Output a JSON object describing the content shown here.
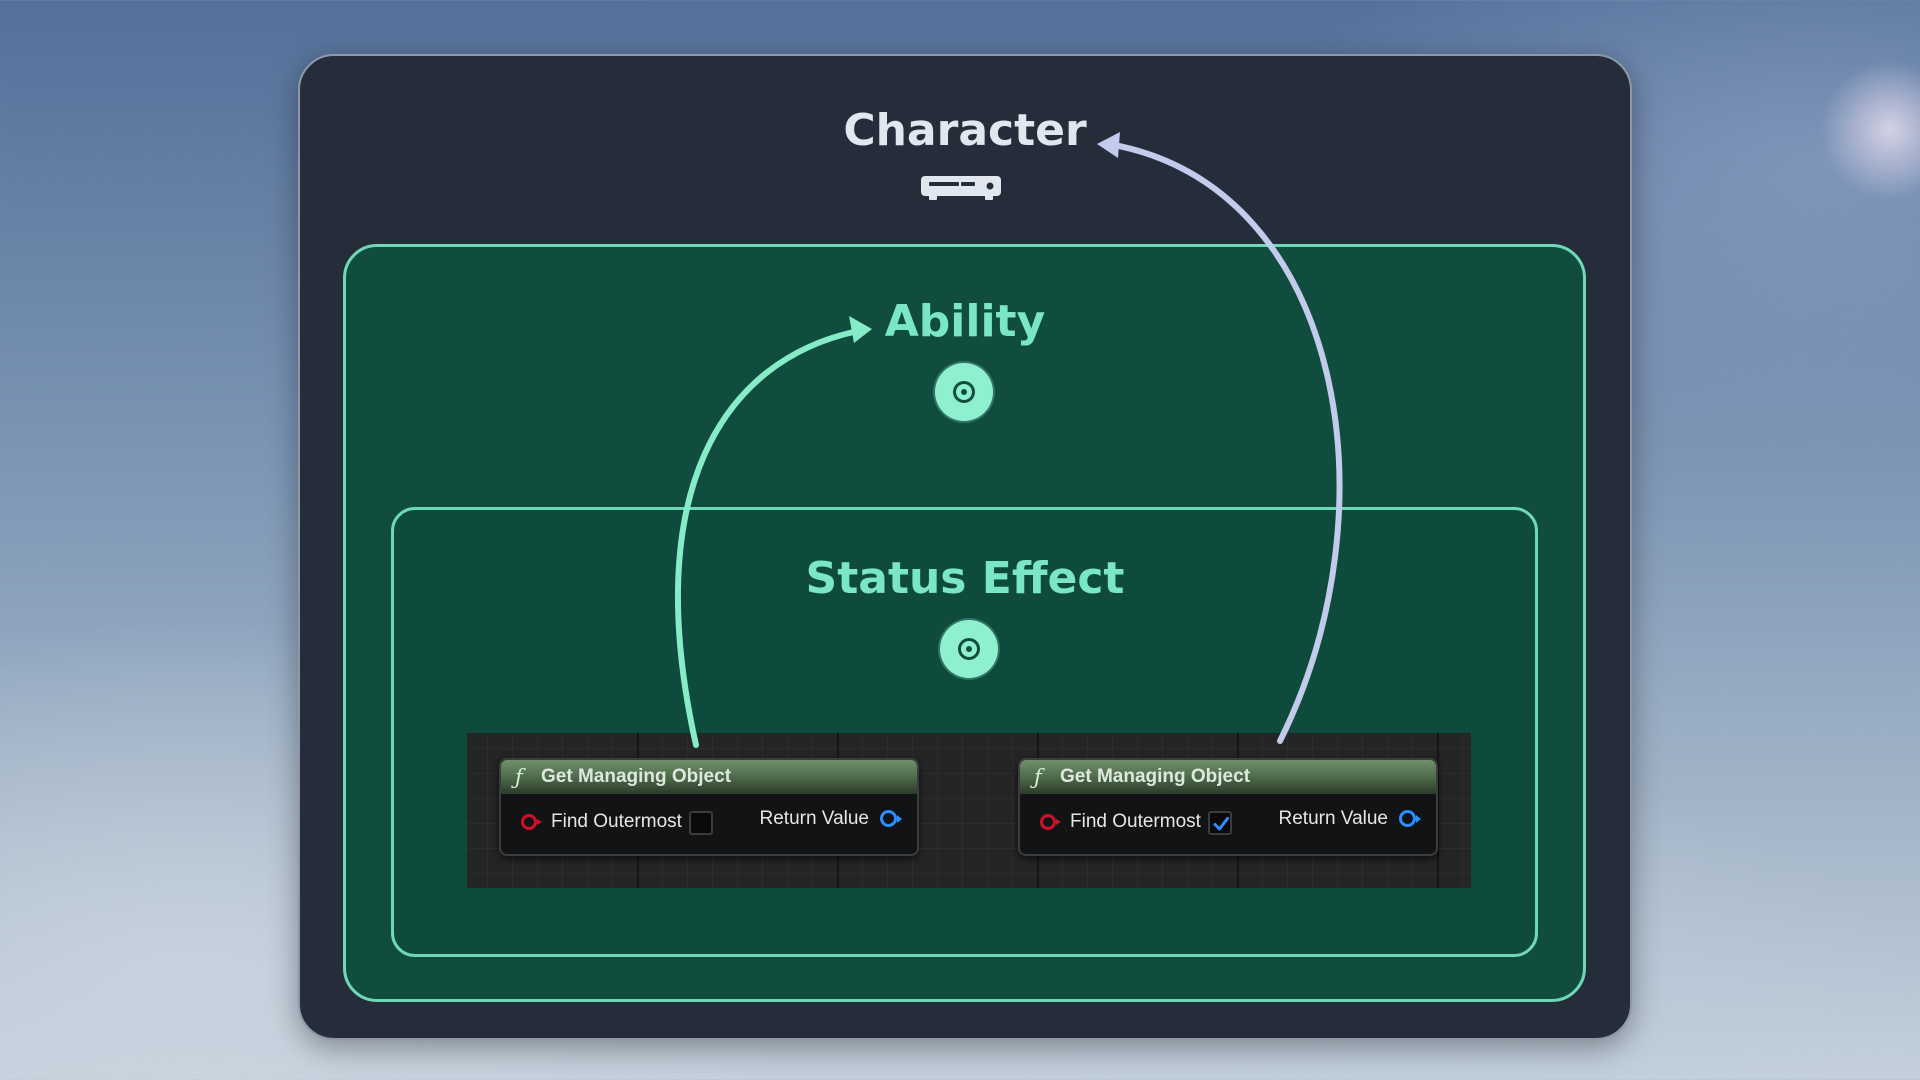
{
  "levels": {
    "character": {
      "title": "Character",
      "icon": "gamepad-console-icon"
    },
    "ability": {
      "title": "Ability",
      "icon": "target-icon"
    },
    "status_effect": {
      "title": "Status Effect",
      "icon": "target-icon"
    }
  },
  "nodes": [
    {
      "title": "Get Managing Object",
      "find_outermost_label": "Find Outermost",
      "find_outermost_checked": false,
      "return_label": "Return Value"
    },
    {
      "title": "Get Managing Object",
      "find_outermost_label": "Find Outermost",
      "find_outermost_checked": true,
      "return_label": "Return Value"
    }
  ],
  "colors": {
    "outer_panel": "#252d3b",
    "inner_panel": "#114d3e",
    "panel_border": "#6fd9b7",
    "arrow_green": "#86ecc8",
    "arrow_lavender": "#c2cbeb",
    "exec_pin": "#d0102a",
    "data_pin": "#2a8fff"
  }
}
